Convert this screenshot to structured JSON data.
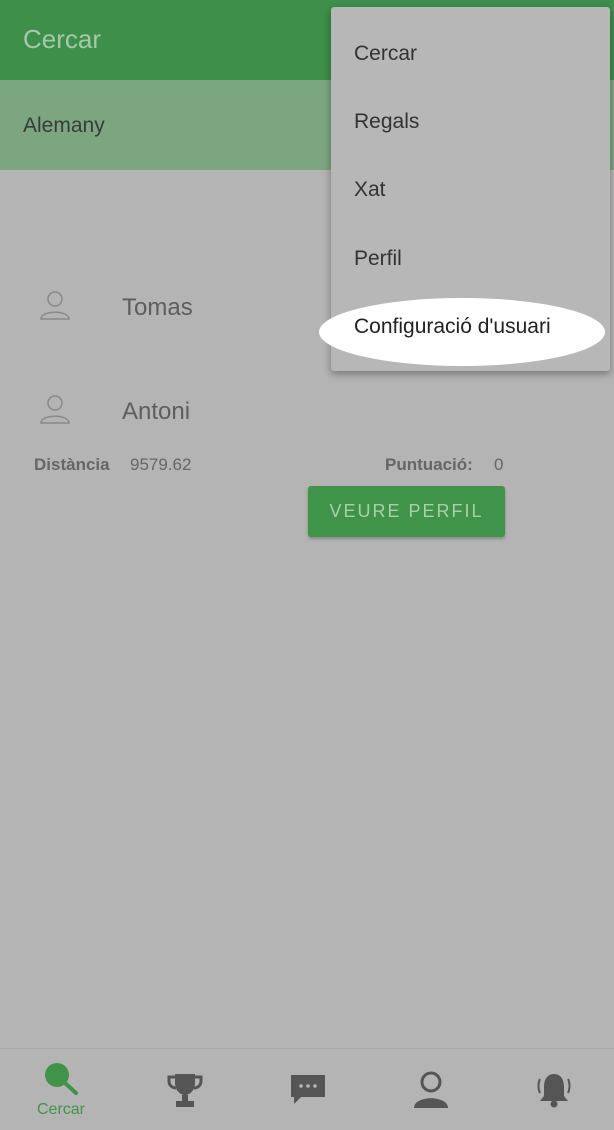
{
  "appbar": {
    "title": "Cercar"
  },
  "filter": {
    "language": "Alemany"
  },
  "users": [
    {
      "name": "Tomas"
    },
    {
      "name": "Antoni"
    }
  ],
  "details": {
    "distance_label": "Distància",
    "distance_value": "9579.62",
    "score_label": "Puntuació:",
    "score_value": "0",
    "view_profile_button": "VEURE PERFIL"
  },
  "menu": {
    "items": [
      "Cercar",
      "Regals",
      "Xat",
      "Perfil",
      "Configuració d'usuari"
    ]
  },
  "bottom_nav": {
    "items": [
      {
        "label": "Cercar",
        "icon": "search-icon",
        "active": true
      },
      {
        "label": "",
        "icon": "trophy-icon",
        "active": false
      },
      {
        "label": "",
        "icon": "chat-icon",
        "active": false
      },
      {
        "label": "",
        "icon": "profile-icon",
        "active": false
      },
      {
        "label": "",
        "icon": "bell-icon",
        "active": false
      }
    ]
  },
  "colors": {
    "primary": "#3d8f4a",
    "overlay": "#b4b4b4",
    "accent_active": "#3f9449"
  }
}
